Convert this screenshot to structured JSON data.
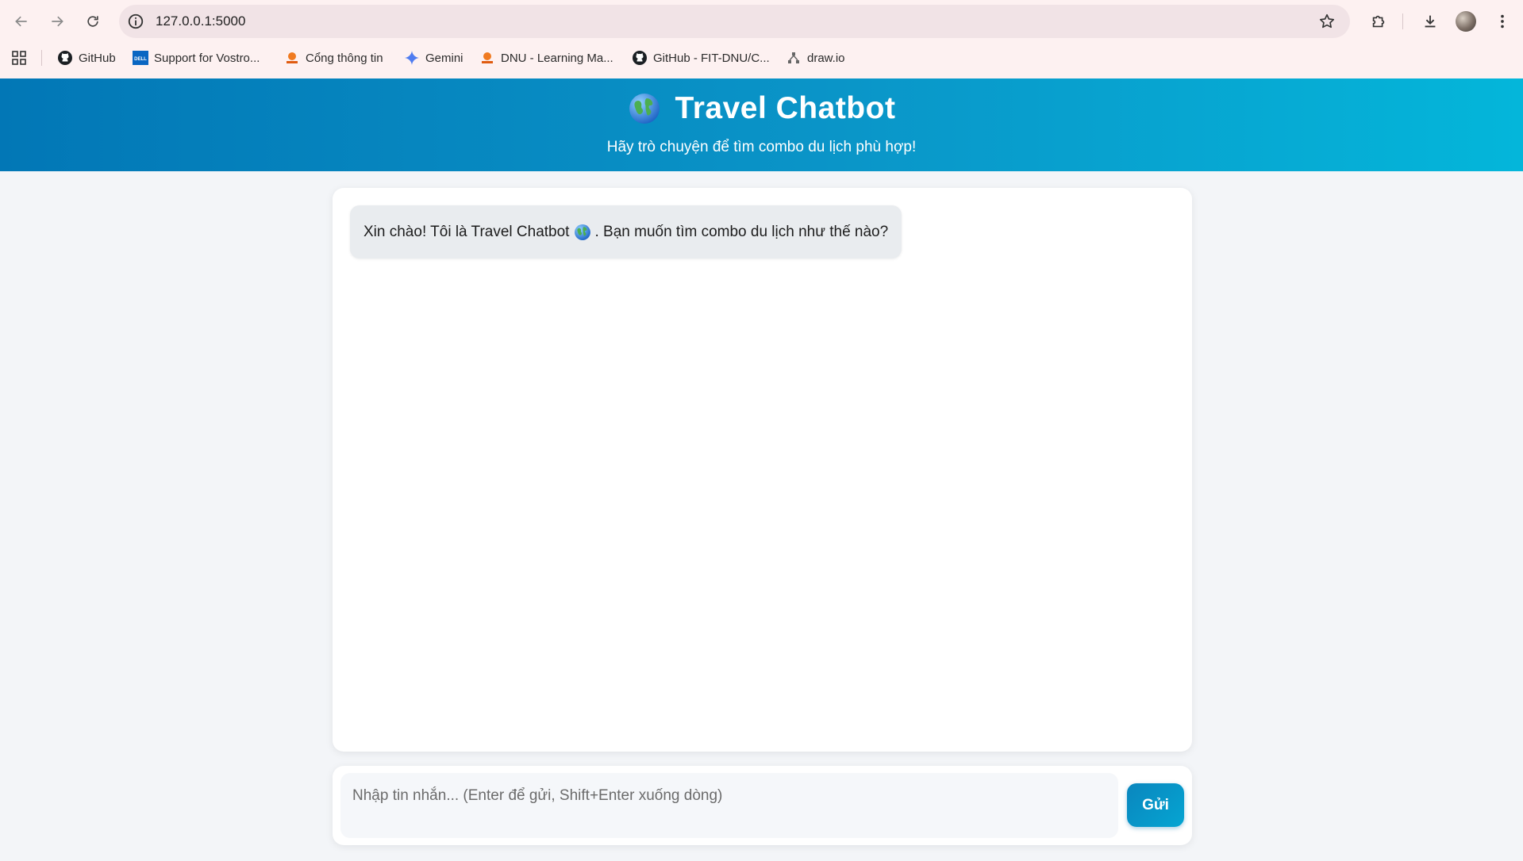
{
  "browser": {
    "url": "127.0.0.1:5000",
    "bookmarks": [
      {
        "label": "GitHub",
        "icon": "github-icon"
      },
      {
        "label": "Support for Vostro...",
        "icon": "dell-icon"
      },
      {
        "label": "Cổng thông tin",
        "icon": "dnu-logo-icon"
      },
      {
        "label": "Gemini",
        "icon": "gemini-icon"
      },
      {
        "label": "DNU - Learning Ma...",
        "icon": "dnu-logo-icon"
      },
      {
        "label": "GitHub - FIT-DNU/C...",
        "icon": "github-icon"
      },
      {
        "label": "draw.io",
        "icon": "drawio-icon"
      }
    ]
  },
  "header": {
    "title": "Travel Chatbot",
    "subtitle": "Hãy trò chuyện để tìm combo du lịch phù hợp!",
    "icon": "globe-icon",
    "gradient_start": "#0277b6",
    "gradient_end": "#04b6da"
  },
  "chat": {
    "messages": [
      {
        "role": "bot",
        "text_before": "Xin chào! Tôi là Travel Chatbot",
        "text_after": ". Bạn muốn tìm combo du lịch như thế nào?",
        "icon": "globe-icon"
      }
    ]
  },
  "composer": {
    "placeholder": "Nhập tin nhắn... (Enter để gửi, Shift+Enter xuống dòng)",
    "value": "",
    "send_label": "Gửi"
  }
}
